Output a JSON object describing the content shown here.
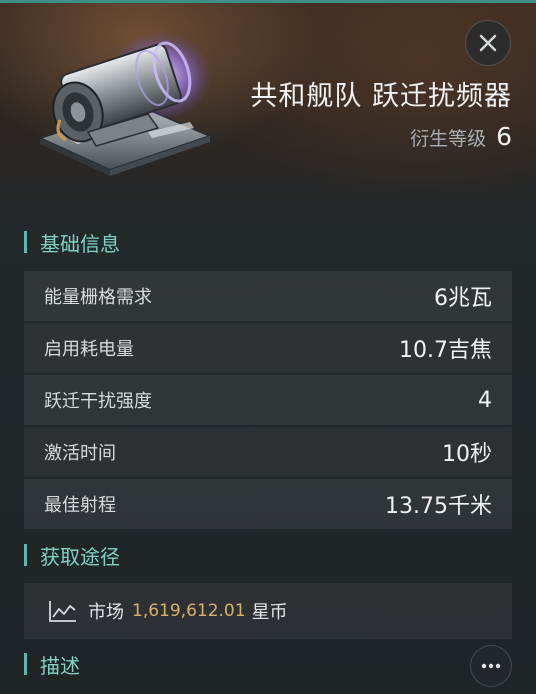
{
  "item": {
    "name": "共和舰队 跃迁扰频器",
    "meta_label": "衍生等级",
    "meta_value": "6",
    "image_icon": "warp-scrambler-module-icon"
  },
  "actions": {
    "close_icon": "close-icon",
    "more_icon": "ellipsis-icon"
  },
  "sections": {
    "basic_info": "基础信息",
    "acquire": "获取途径",
    "description": "描述"
  },
  "attributes": [
    {
      "name": "能量栅格需求",
      "value": "6兆瓦"
    },
    {
      "name": "启用耗电量",
      "value": "10.7吉焦"
    },
    {
      "name": "跃迁干扰强度",
      "value": "4"
    },
    {
      "name": "激活时间",
      "value": "10秒"
    },
    {
      "name": "最佳射程",
      "value": "13.75千米"
    }
  ],
  "market": {
    "icon": "trend-chart-icon",
    "label": "市场",
    "price": "1,619,612.01",
    "unit": "星币"
  },
  "colors": {
    "accent": "#7fd3c6",
    "price": "#d9b26a",
    "top_bar": "#3e8f88"
  }
}
